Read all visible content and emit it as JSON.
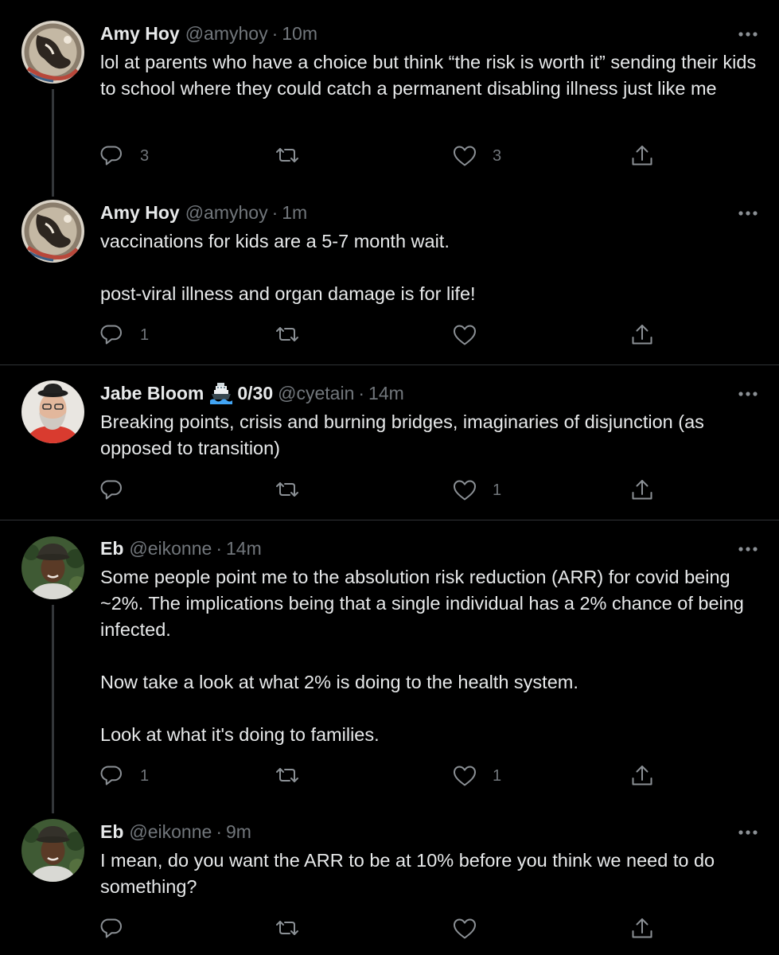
{
  "tweets": [
    {
      "name": "Amy Hoy",
      "handle": "@amyhoy",
      "sep": "·",
      "time": "10m",
      "text": "lol at parents who have a choice but think “the risk is worth it” sending their kids to school where they could catch a permanent disabling illness just like me",
      "replies": "3",
      "retweets": "",
      "likes": "3"
    },
    {
      "name": "Amy Hoy",
      "handle": "@amyhoy",
      "sep": "·",
      "time": "1m",
      "text": "vaccinations for kids are a 5-7 month wait.\n\npost-viral illness and organ damage is for life!",
      "replies": "1",
      "retweets": "",
      "likes": ""
    },
    {
      "name": "Jabe Bloom",
      "badge": "0/30",
      "handle": "@cyetain",
      "sep": "·",
      "time": "14m",
      "text": "Breaking points, crisis and burning bridges, imaginaries of disjunction (as opposed to transition)",
      "replies": "",
      "retweets": "",
      "likes": "1"
    },
    {
      "name": "Eb",
      "handle": "@eikonne",
      "sep": "·",
      "time": "14m",
      "text": "Some people point me to the absolution risk reduction (ARR) for covid being ~2%. The implications being that a single individual has a 2% chance of being infected.\n\nNow take a look at what 2% is doing to the health system.\n\nLook at what it's doing to families.",
      "replies": "1",
      "retweets": "",
      "likes": "1"
    },
    {
      "name": "Eb",
      "handle": "@eikonne",
      "sep": "·",
      "time": "9m",
      "text": "I mean, do you want the ARR to be at 10% before you think we need to do something?",
      "replies": "",
      "retweets": "",
      "likes": ""
    }
  ],
  "icons": {
    "reply": "reply-icon",
    "retweet": "retweet-icon",
    "like": "heart-icon",
    "share": "share-icon",
    "more": "more-icon",
    "emoji": "ship-emoji-icon"
  },
  "colors": {
    "background": "#000000",
    "text": "#e7e9ea",
    "secondary": "#71767b",
    "divider": "#2f3336"
  }
}
